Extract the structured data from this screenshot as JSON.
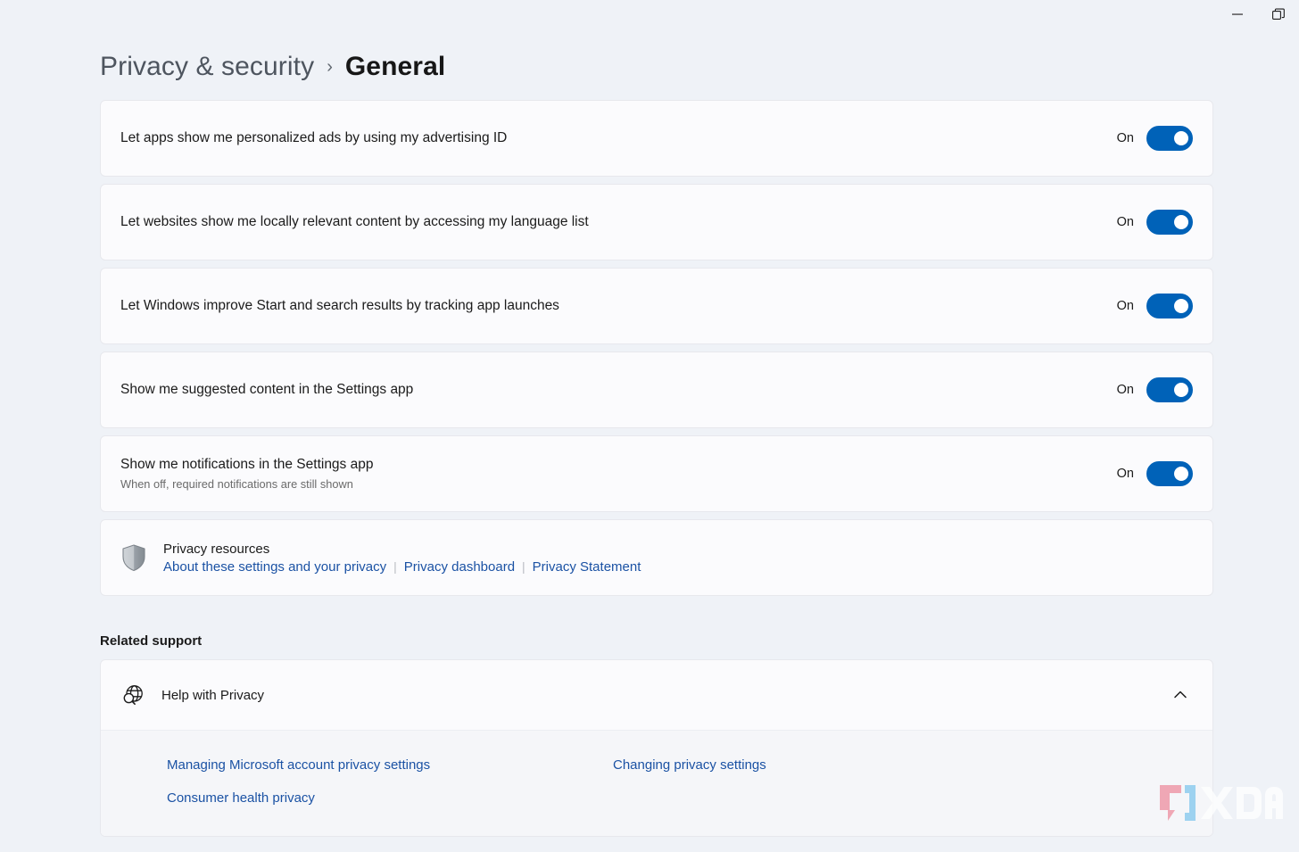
{
  "titlebar": {
    "minimize_label": "Minimize",
    "restore_label": "Restore",
    "minimize_icon": "minimize-icon",
    "restore_icon": "restore-icon"
  },
  "breadcrumb": {
    "parent": "Privacy & security",
    "separator": "›",
    "current": "General"
  },
  "settings": [
    {
      "title": "Let apps show me personalized ads by using my advertising ID",
      "subtitle": "",
      "state_label": "On",
      "state": true
    },
    {
      "title": "Let websites show me locally relevant content by accessing my language list",
      "subtitle": "",
      "state_label": "On",
      "state": true
    },
    {
      "title": "Let Windows improve Start and search results by tracking app launches",
      "subtitle": "",
      "state_label": "On",
      "state": true
    },
    {
      "title": "Show me suggested content in the Settings app",
      "subtitle": "",
      "state_label": "On",
      "state": true
    },
    {
      "title": "Show me notifications in the Settings app",
      "subtitle": "When off, required notifications are still shown",
      "state_label": "On",
      "state": true
    }
  ],
  "privacy_resources": {
    "icon": "shield-icon",
    "title": "Privacy resources",
    "links": [
      "About these settings and your privacy",
      "Privacy dashboard",
      "Privacy Statement"
    ],
    "separator": "|"
  },
  "related_support": {
    "heading": "Related support",
    "expander": {
      "icon": "globe-search-icon",
      "title": "Help with Privacy",
      "chevron": "chevron-up-icon",
      "expanded": true,
      "links": [
        "Managing Microsoft account privacy settings",
        "Changing privacy settings",
        "Consumer health privacy"
      ]
    }
  },
  "watermark": {
    "text": "XDA"
  },
  "colors": {
    "background": "#eff2f7",
    "card": "#fbfbfd",
    "card_border": "#e7e8ed",
    "accent_toggle": "#0062b8",
    "link": "#1b52a4",
    "text_primary": "#1b1b1b",
    "text_secondary": "#6a6a6a",
    "breadcrumb_parent": "#4e555f",
    "expander_body": "#f5f6f9"
  }
}
